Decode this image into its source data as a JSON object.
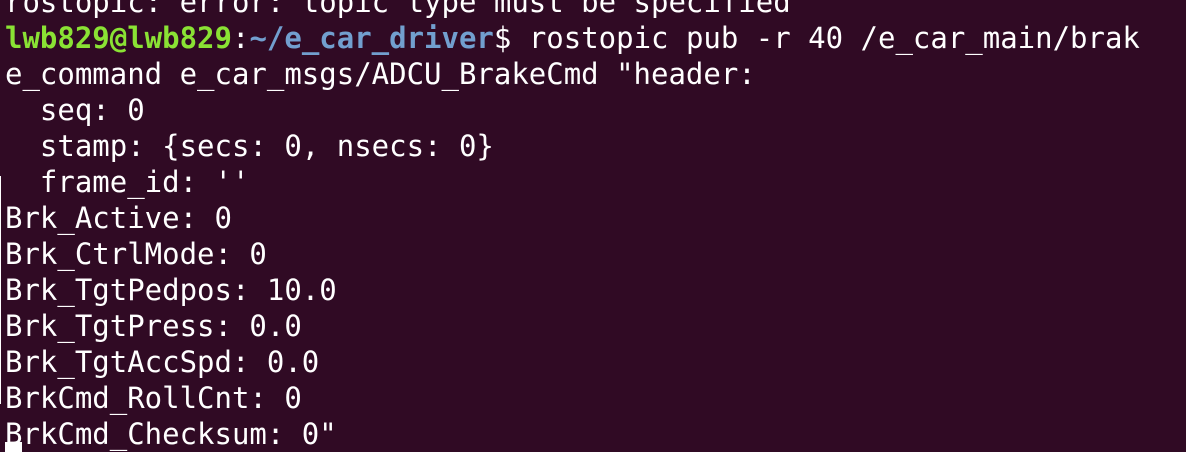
{
  "terminal": {
    "lines": {
      "l0": "rostopic: error: topic type must be specified",
      "l1_userhost": "lwb829@lwb829",
      "l1_colon": ":",
      "l1_path": "~/e_car_driver",
      "l1_prompt": "$ ",
      "l1_command": "rostopic pub -r 40 /e_car_main/brak",
      "l2": "e_command e_car_msgs/ADCU_BrakeCmd \"header:",
      "l3": "  seq: 0",
      "l4": "  stamp: {secs: 0, nsecs: 0}",
      "l5": "  frame_id: ''",
      "l6": "Brk_Active: 0",
      "l7": "Brk_CtrlMode: 0",
      "l8": "Brk_TgtPedpos: 10.0",
      "l9": "Brk_TgtPress: 0.0",
      "l10": "Brk_TgtAccSpd: 0.0",
      "l11": "BrkCmd_RollCnt: 0",
      "l12": "BrkCmd_Checksum: 0\""
    },
    "colors": {
      "background": "#300a24",
      "text": "#ffffff",
      "user_host": "#8ae234",
      "path": "#729fcf"
    }
  }
}
